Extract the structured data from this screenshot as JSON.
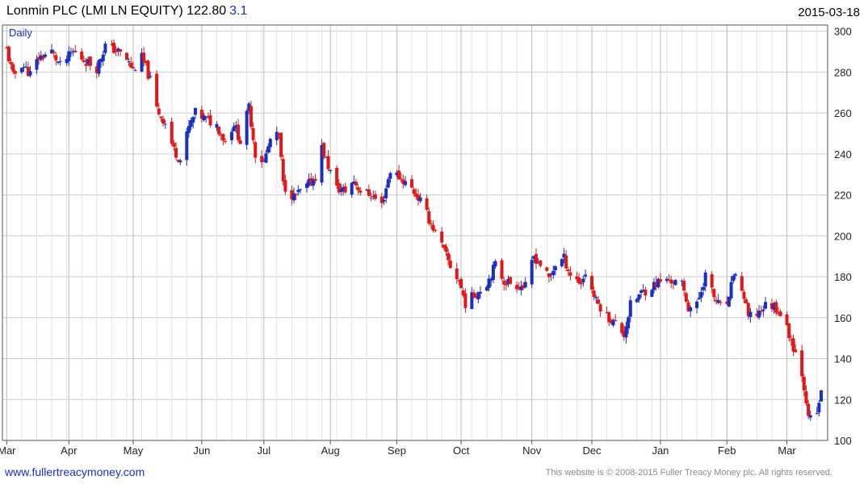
{
  "header": {
    "title": "Lonmin PLC (LMI LN EQUITY) 122.80",
    "change": "3.1",
    "date": "2015-03-18"
  },
  "footer": {
    "website": "www.fullertreacymoney.com",
    "copyright": "This website is © 2008-2015 Fuller Treacy Money plc. All rights reserved."
  },
  "colors": {
    "up": "#1a2fc0",
    "down": "#e01818",
    "grid": "#cccccc",
    "frame": "#555555"
  },
  "chart_data": {
    "type": "candlestick",
    "period_label": "Daily",
    "ylim": [
      100,
      303
    ],
    "yticks": [
      100,
      120,
      140,
      160,
      180,
      200,
      220,
      240,
      260,
      280,
      300
    ],
    "x_tick_labels": [
      "Mar",
      "Apr",
      "May",
      "Jun",
      "Jul",
      "Aug",
      "Sep",
      "Oct",
      "Nov",
      "Dec",
      "Jan",
      "Feb",
      "Mar"
    ],
    "x_tick_dates": [
      "2014-03-03",
      "2014-04-01",
      "2014-05-01",
      "2014-06-02",
      "2014-07-01",
      "2014-08-01",
      "2014-09-01",
      "2014-10-01",
      "2014-11-03",
      "2014-12-01",
      "2015-01-02",
      "2015-02-02",
      "2015-03-02"
    ],
    "anchors": [
      [
        "2014-03-03",
        291
      ],
      [
        "2014-03-06",
        278
      ],
      [
        "2014-03-10",
        284
      ],
      [
        "2014-03-14",
        279
      ],
      [
        "2014-03-18",
        287
      ],
      [
        "2014-03-24",
        290
      ],
      [
        "2014-03-28",
        283
      ],
      [
        "2014-04-03",
        290
      ],
      [
        "2014-04-08",
        286
      ],
      [
        "2014-04-14",
        282
      ],
      [
        "2014-04-18",
        293
      ],
      [
        "2014-04-24",
        290
      ],
      [
        "2014-04-28",
        286
      ],
      [
        "2014-05-01",
        281
      ],
      [
        "2014-05-05",
        287
      ],
      [
        "2014-05-07",
        282
      ],
      [
        "2014-05-09",
        276
      ],
      [
        "2014-05-12",
        262
      ],
      [
        "2014-05-16",
        255
      ],
      [
        "2014-05-20",
        242
      ],
      [
        "2014-05-23",
        237
      ],
      [
        "2014-05-27",
        253
      ],
      [
        "2014-05-30",
        260
      ],
      [
        "2014-06-04",
        257
      ],
      [
        "2014-06-09",
        254
      ],
      [
        "2014-06-13",
        246
      ],
      [
        "2014-06-17",
        255
      ],
      [
        "2014-06-20",
        246
      ],
      [
        "2014-06-24",
        263
      ],
      [
        "2014-06-27",
        240
      ],
      [
        "2014-07-01",
        236
      ],
      [
        "2014-07-04",
        247
      ],
      [
        "2014-07-08",
        249
      ],
      [
        "2014-07-10",
        225
      ],
      [
        "2014-07-15",
        219
      ],
      [
        "2014-07-21",
        224
      ],
      [
        "2014-07-25",
        229
      ],
      [
        "2014-07-28",
        243
      ],
      [
        "2014-07-31",
        234
      ],
      [
        "2014-08-04",
        223
      ],
      [
        "2014-08-08",
        222
      ],
      [
        "2014-08-12",
        227
      ],
      [
        "2014-08-15",
        222
      ],
      [
        "2014-08-20",
        220
      ],
      [
        "2014-08-25",
        215
      ],
      [
        "2014-08-29",
        232
      ],
      [
        "2014-09-03",
        228
      ],
      [
        "2014-09-08",
        223
      ],
      [
        "2014-09-12",
        217
      ],
      [
        "2014-09-17",
        206
      ],
      [
        "2014-09-22",
        195
      ],
      [
        "2014-09-26",
        185
      ],
      [
        "2014-09-30",
        178
      ],
      [
        "2014-10-03",
        167
      ],
      [
        "2014-10-07",
        171
      ],
      [
        "2014-10-13",
        177
      ],
      [
        "2014-10-17",
        186
      ],
      [
        "2014-10-21",
        178
      ],
      [
        "2014-10-27",
        176
      ],
      [
        "2014-10-31",
        175
      ],
      [
        "2014-11-04",
        190
      ],
      [
        "2014-11-07",
        186
      ],
      [
        "2014-11-11",
        179
      ],
      [
        "2014-11-14",
        186
      ],
      [
        "2014-11-18",
        189
      ],
      [
        "2014-11-21",
        181
      ],
      [
        "2014-11-26",
        177
      ],
      [
        "2014-11-28",
        182
      ],
      [
        "2014-12-03",
        168
      ],
      [
        "2014-12-08",
        161
      ],
      [
        "2014-12-12",
        157
      ],
      [
        "2014-12-16",
        152
      ],
      [
        "2014-12-19",
        166
      ],
      [
        "2014-12-24",
        172
      ],
      [
        "2015-01-02",
        178
      ],
      [
        "2015-01-07",
        178
      ],
      [
        "2015-01-12",
        176
      ],
      [
        "2015-01-15",
        165
      ],
      [
        "2015-01-19",
        166
      ],
      [
        "2015-01-23",
        181
      ],
      [
        "2015-01-27",
        170
      ],
      [
        "2015-01-30",
        165
      ],
      [
        "2015-02-03",
        168
      ],
      [
        "2015-02-05",
        182
      ],
      [
        "2015-02-09",
        174
      ],
      [
        "2015-02-12",
        160
      ],
      [
        "2015-02-16",
        162
      ],
      [
        "2015-02-20",
        166
      ],
      [
        "2015-02-24",
        166
      ],
      [
        "2015-02-27",
        162
      ],
      [
        "2015-03-03",
        152
      ],
      [
        "2015-03-06",
        143
      ],
      [
        "2015-03-09",
        133
      ],
      [
        "2015-03-11",
        120
      ],
      [
        "2015-03-12",
        110
      ],
      [
        "2015-03-16",
        113
      ],
      [
        "2015-03-17",
        119
      ],
      [
        "2015-03-18",
        122.8
      ]
    ],
    "series": [
      {
        "name": "LMI LN EQUITY",
        "style": "daily candlesticks"
      }
    ],
    "grid": true,
    "y_axis_position": "right"
  }
}
